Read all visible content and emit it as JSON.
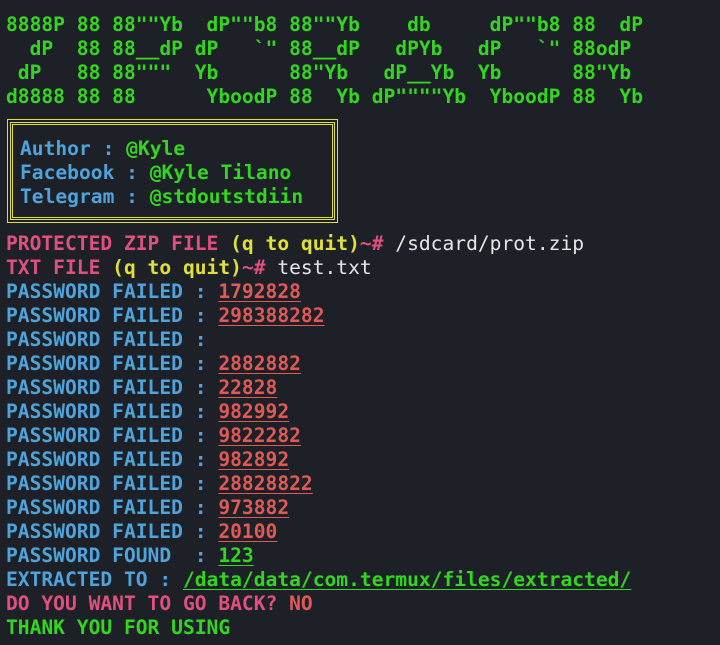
{
  "banner": [
    "8888P 88 88\"\"Yb  dP\"\"b8 88\"\"Yb    db     dP\"\"b8 88  dP",
    "  dP  88 88__dP dP   `\" 88__dP   dPYb   dP   `\" 88odP",
    " dP   88 88\"\"\"  Yb      88\"Yb   dP__Yb  Yb      88\"Yb",
    "d8888 88 88      YboodP 88  Yb dP\"\"\"\"Yb  YboodP 88  Yb"
  ],
  "info": {
    "author_label": "Author : ",
    "author_value": "@Kyle",
    "facebook_label": "Facebook : ",
    "facebook_value": "@Kyle Tilano",
    "telegram_label": "Telegram : ",
    "telegram_value": "@stdoutstdiin"
  },
  "prompts": {
    "zip_prompt": "PROTECTED ZIP FILE ",
    "zip_quit": "(q to quit)",
    "zip_suffix": "~# ",
    "zip_input": "/sdcard/prot.zip",
    "txt_prompt": "TXT FILE ",
    "txt_quit": "(q to quit)",
    "txt_suffix": "~# ",
    "txt_input": "test.txt"
  },
  "attempts": [
    {
      "label": "PASSWORD FAILED : ",
      "value": "1792828"
    },
    {
      "label": "PASSWORD FAILED : ",
      "value": "298388282"
    },
    {
      "label": "PASSWORD FAILED : ",
      "value": ""
    },
    {
      "label": "PASSWORD FAILED : ",
      "value": "2882882"
    },
    {
      "label": "PASSWORD FAILED : ",
      "value": "22828"
    },
    {
      "label": "PASSWORD FAILED : ",
      "value": "982992"
    },
    {
      "label": "PASSWORD FAILED : ",
      "value": "9822282"
    },
    {
      "label": "PASSWORD FAILED : ",
      "value": "982892"
    },
    {
      "label": "PASSWORD FAILED : ",
      "value": "28828822"
    },
    {
      "label": "PASSWORD FAILED : ",
      "value": "973882"
    },
    {
      "label": "PASSWORD FAILED : ",
      "value": "20100"
    }
  ],
  "found": {
    "label": "PASSWORD FOUND  : ",
    "value": "123"
  },
  "extracted": {
    "label": "EXTRACTED TO : ",
    "path": "/data/data/com.termux/files/extracted/"
  },
  "go_back": {
    "question": "DO YOU WANT TO GO BACK? ",
    "answer": "NO"
  },
  "thanks": "THANK YOU FOR USING",
  "colors": {
    "background": "#1d2127",
    "green": "#33d61f",
    "blue": "#4ea3db",
    "pink": "#e0507e",
    "yellow": "#e0e036",
    "red": "#e05a55"
  }
}
